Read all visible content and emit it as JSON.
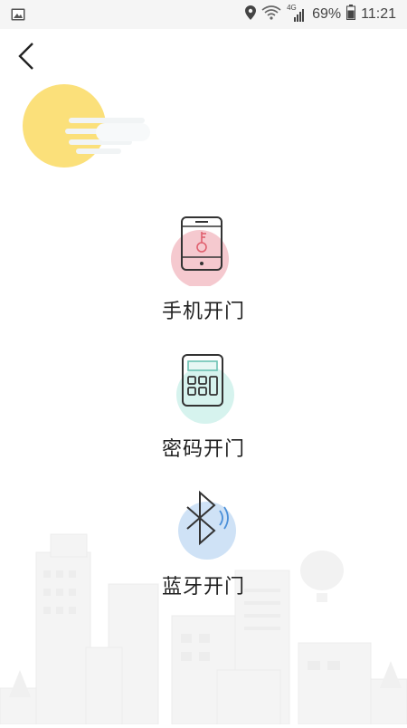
{
  "status_bar": {
    "battery": "69%",
    "time": "11:21",
    "network": "4G",
    "icons": [
      "image-icon",
      "location-icon",
      "wifi-icon",
      "signal-icon",
      "battery-icon"
    ]
  },
  "nav": {
    "back_icon": "chevron-left-icon"
  },
  "header": {
    "weather_icon": "sun-cloud-icon",
    "sun_color": "#fbe07a"
  },
  "options": [
    {
      "label": "手机开门",
      "icon": "phone-key-icon",
      "accent": "#f5c9cf"
    },
    {
      "label": "密码开门",
      "icon": "keypad-icon",
      "accent": "#d6f3ee"
    },
    {
      "label": "蓝牙开门",
      "icon": "bluetooth-icon",
      "accent": "#cfe2f6"
    }
  ],
  "background": {
    "illustration": "city-skyline"
  }
}
